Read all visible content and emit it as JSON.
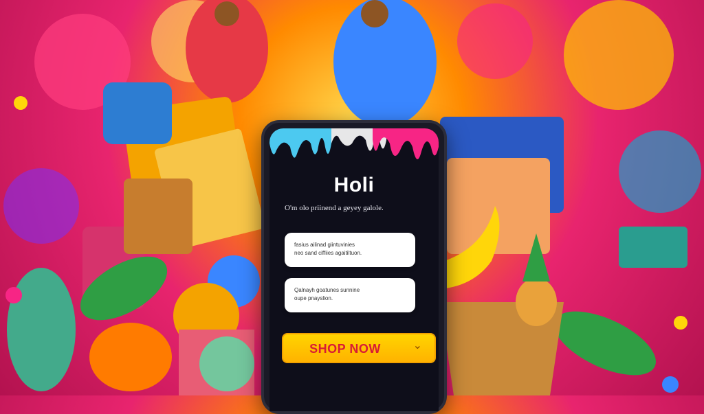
{
  "app": {
    "title": "Holi",
    "tagline": "O'm olo priinend a geyey galole."
  },
  "cards": [
    {
      "line1": "fasius ailinad giintuvinies",
      "line2": "neo sand ciffiies agaitiltuon."
    },
    {
      "line1": "Qalnayh goatunes sunnine",
      "line2": "oupe pnayslion."
    }
  ],
  "cta": {
    "label": "SHOP NOW",
    "icon": "chevron-down-icon"
  },
  "colors": {
    "accent": "#ffc400",
    "cta_text": "#d81b35",
    "screen_bg": "#0e0e1a",
    "background": "#e8246e"
  }
}
